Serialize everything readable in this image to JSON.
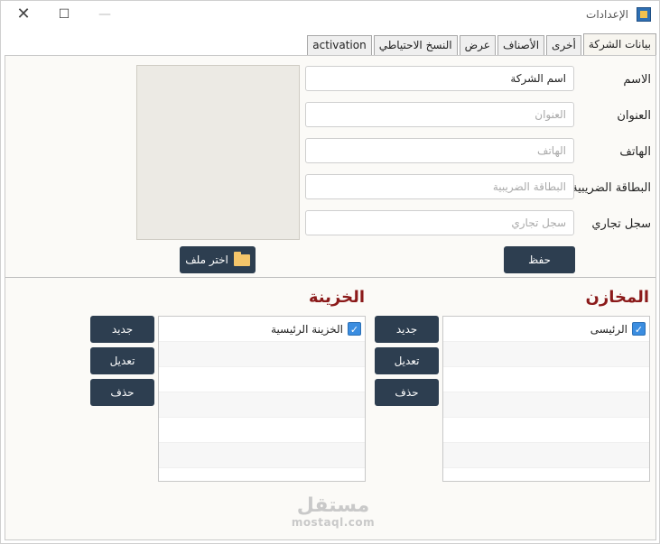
{
  "window": {
    "title": "الإعدادات"
  },
  "tabs": [
    {
      "label": "بيانات الشركة",
      "active": true
    },
    {
      "label": "أخرى",
      "active": false
    },
    {
      "label": "الأصناف",
      "active": false
    },
    {
      "label": "عرض",
      "active": false
    },
    {
      "label": "النسخ الاحتياطي",
      "active": false
    },
    {
      "label": "activation",
      "active": false
    }
  ],
  "company": {
    "name_label": "الاسم",
    "name_value": "اسم الشركة",
    "address_label": "العنوان",
    "address_placeholder": "العنوان",
    "phone_label": "الهاتف",
    "phone_placeholder": "الهاتف",
    "tax_label": "البطاقة الضريبية",
    "tax_placeholder": "البطاقة الضريبية",
    "register_label": "سجل تجاري",
    "register_placeholder": "سجل تجاري",
    "save_button": "حفظ",
    "choose_file_button": "اختر ملف"
  },
  "stores": {
    "title": "المخازن",
    "items": [
      {
        "label": "الرئيسى",
        "checked": true
      }
    ],
    "new_button": "جديد",
    "edit_button": "تعديل",
    "delete_button": "حذف"
  },
  "treasury": {
    "title": "الخزينة",
    "items": [
      {
        "label": "الخزينة الرئيسية",
        "checked": true
      }
    ],
    "new_button": "جديد",
    "edit_button": "تعديل",
    "delete_button": "حذف"
  },
  "watermark": {
    "arabic": "مستقل",
    "latin": "mostaql.com"
  },
  "colors": {
    "button_bg": "#2d3e50",
    "section_title": "#8b1a1a",
    "checkbox": "#3b8de0"
  }
}
